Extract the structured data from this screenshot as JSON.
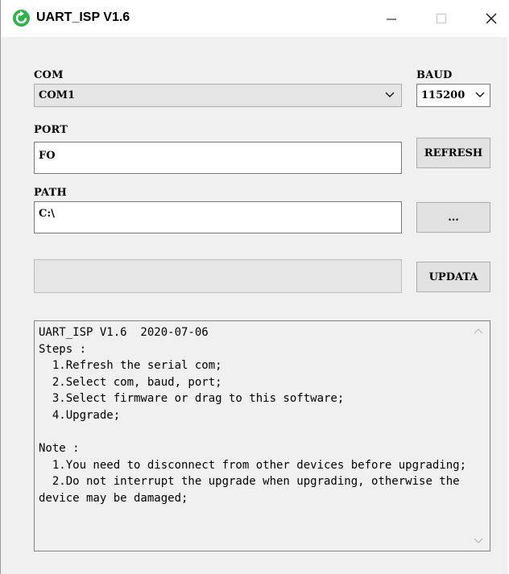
{
  "window": {
    "title": "UART_ISP V1.6",
    "icon": "refresh-arrow-icon",
    "accent_color": "#2db34a"
  },
  "com": {
    "label": "COM",
    "value": "COM1"
  },
  "baud": {
    "label": "BAUD",
    "value": "115200"
  },
  "port": {
    "label": "PORT",
    "value": "FO"
  },
  "refresh_button": {
    "label": "REFRESH"
  },
  "path": {
    "label": "PATH",
    "value": "C:\\"
  },
  "browse_button": {
    "label": "..."
  },
  "progress": {
    "percent": 0
  },
  "update_button": {
    "label": "UPDATA"
  },
  "log": {
    "text": "UART_ISP V1.6  2020-07-06\nSteps :\n  1.Refresh the serial com;\n  2.Select com, baud, port;\n  3.Select firmware or drag to this software;\n  4.Upgrade;\n\nNote :\n  1.You need to disconnect from other devices before upgrading;\n  2.Do not interrupt the upgrade when upgrading, otherwise the device may be damaged;"
  }
}
